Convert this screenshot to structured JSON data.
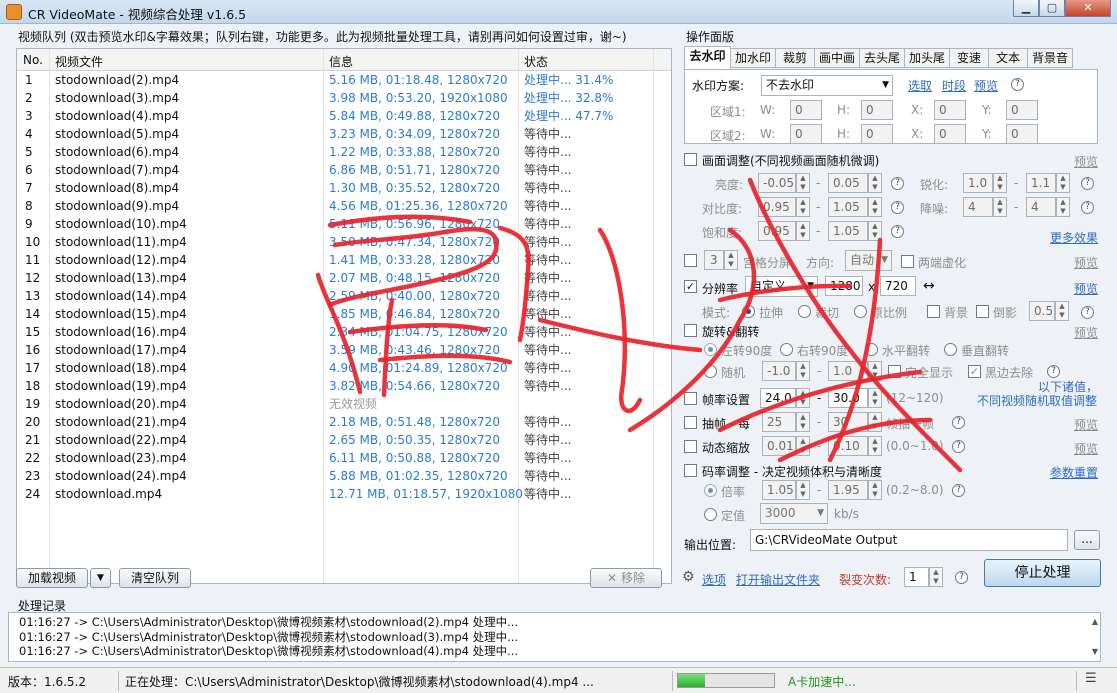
{
  "window": {
    "title": "CR VideoMate - 视频综合处理 v1.6.5"
  },
  "queue": {
    "group_label": "视频队列 (双击预览水印&字幕效果；队列右键，功能更多。此为视频批量处理工具，请别再问如何设置过审，谢~)",
    "columns": {
      "no": "No.",
      "file": "视频文件",
      "info": "信息",
      "status": "状态"
    },
    "rows": [
      {
        "no": "1",
        "file": "stodownload(2).mp4",
        "info": "5.16 MB, 01:18.48, 1280x720",
        "status": "处理中... 31.4%"
      },
      {
        "no": "2",
        "file": "stodownload(3).mp4",
        "info": "3.98 MB, 0:53.20, 1920x1080",
        "status": "处理中... 32.8%"
      },
      {
        "no": "3",
        "file": "stodownload(4).mp4",
        "info": "5.84 MB, 0:49.88, 1280x720",
        "status": "处理中... 47.7%"
      },
      {
        "no": "4",
        "file": "stodownload(5).mp4",
        "info": "3.23 MB, 0:34.09, 1280x720",
        "status": "等待中..."
      },
      {
        "no": "5",
        "file": "stodownload(6).mp4",
        "info": "1.22 MB, 0:33.88, 1280x720",
        "status": "等待中..."
      },
      {
        "no": "6",
        "file": "stodownload(7).mp4",
        "info": "6.86 MB, 0:51.71, 1280x720",
        "status": "等待中..."
      },
      {
        "no": "7",
        "file": "stodownload(8).mp4",
        "info": "1.30 MB, 0:35.52, 1280x720",
        "status": "等待中..."
      },
      {
        "no": "8",
        "file": "stodownload(9).mp4",
        "info": "4.56 MB, 01:25.36, 1280x720",
        "status": "等待中..."
      },
      {
        "no": "9",
        "file": "stodownload(10).mp4",
        "info": "5.11 MB, 0:56.96, 1280x720",
        "status": "等待中..."
      },
      {
        "no": "10",
        "file": "stodownload(11).mp4",
        "info": "3.50 MB, 0:47.34, 1280x720",
        "status": "等待中..."
      },
      {
        "no": "11",
        "file": "stodownload(12).mp4",
        "info": "1.41 MB, 0:33.28, 1280x720",
        "status": "等待中..."
      },
      {
        "no": "12",
        "file": "stodownload(13).mp4",
        "info": "2.07 MB, 0:48.15, 1280x720",
        "status": "等待中..."
      },
      {
        "no": "13",
        "file": "stodownload(14).mp4",
        "info": "2.59 MB, 0:40.00, 1280x720",
        "status": "等待中..."
      },
      {
        "no": "14",
        "file": "stodownload(15).mp4",
        "info": "1.85 MB, 0:46.84, 1280x720",
        "status": "等待中..."
      },
      {
        "no": "15",
        "file": "stodownload(16).mp4",
        "info": "2.34 MB, 01:04.75, 1280x720",
        "status": "等待中..."
      },
      {
        "no": "16",
        "file": "stodownload(17).mp4",
        "info": "3.59 MB, 0:43.46, 1280x720",
        "status": "等待中..."
      },
      {
        "no": "17",
        "file": "stodownload(18).mp4",
        "info": "4.90 MB, 01:24.89, 1280x720",
        "status": "等待中..."
      },
      {
        "no": "18",
        "file": "stodownload(19).mp4",
        "info": "3.82 MB, 0:54.66, 1280x720",
        "status": "等待中..."
      },
      {
        "no": "19",
        "file": "stodownload(20).mp4",
        "info": "无效视频",
        "status": ""
      },
      {
        "no": "20",
        "file": "stodownload(21).mp4",
        "info": "2.18 MB, 0:51.48, 1280x720",
        "status": "等待中..."
      },
      {
        "no": "21",
        "file": "stodownload(22).mp4",
        "info": "2.65 MB, 0:50.35, 1280x720",
        "status": "等待中..."
      },
      {
        "no": "22",
        "file": "stodownload(23).mp4",
        "info": "6.11 MB, 0:50.88, 1280x720",
        "status": "等待中..."
      },
      {
        "no": "23",
        "file": "stodownload(24).mp4",
        "info": "5.88 MB, 01:02.35, 1280x720",
        "status": "等待中..."
      },
      {
        "no": "24",
        "file": "stodownload.mp4",
        "info": "12.71 MB, 01:18.57, 1920x1080",
        "status": "等待中..."
      }
    ],
    "buttons": {
      "load": "加载视频",
      "clear": "清空队列",
      "remove": "移除"
    }
  },
  "ops": {
    "group_label": "操作面版",
    "tabs": [
      "去水印",
      "加水印",
      "裁剪",
      "画中画",
      "去头尾",
      "加头尾",
      "变速",
      "文本",
      "背景音"
    ],
    "watermark": {
      "scheme_label": "水印方案:",
      "scheme_value": "不去水印",
      "links": [
        "选取",
        "时段",
        "预览"
      ],
      "areas": [
        {
          "label": "区域1:",
          "w": "0",
          "h": "0",
          "x": "0",
          "y": "0"
        },
        {
          "label": "区域2:",
          "w": "0",
          "h": "0",
          "x": "0",
          "y": "0"
        }
      ],
      "w_label": "W:",
      "h_label": "H:",
      "x_label": "X:",
      "y_label": "Y:"
    },
    "picture": {
      "title": "画面调整(不同视频画面随机微调)",
      "preview": "预览",
      "brightness_label": "亮度:",
      "brightness": [
        "-0.05",
        "0.05"
      ],
      "sharpen_label": "锐化:",
      "sharpen": [
        "1.0",
        "1.1"
      ],
      "contrast_label": "对比度:",
      "contrast": [
        "0.95",
        "1.05"
      ],
      "denoise_label": "降噪:",
      "denoise": [
        "4",
        "4"
      ],
      "saturation_label": "饱和度:",
      "saturation": [
        "0.95",
        "1.05"
      ],
      "more": "更多效果"
    },
    "grid": {
      "count": "3",
      "label": "宫格分屏",
      "dir_label": "方向:",
      "dir_value": "自动",
      "blur": "两端虚化",
      "preview": "预览"
    },
    "resolution": {
      "label": "分辨率",
      "preset": "自定义",
      "w": "1280",
      "x": "x",
      "h": "720",
      "link_icon": "↔",
      "preview": "预览",
      "mode_label": "模式:",
      "modes": [
        "拉伸",
        "裁切",
        "原比例"
      ],
      "bg": "背景",
      "reflect": "倒影",
      "reflect_value": "0.5"
    },
    "rotate": {
      "label": "旋转&翻转",
      "options": [
        "左转90度",
        "右转90度",
        "水平翻转",
        "垂直翻转"
      ],
      "random": "随机",
      "range": [
        "-1.0",
        "1.0"
      ],
      "full": "完全显示",
      "blackedge": "黑边去除",
      "preview": "预览"
    },
    "note": [
      "以下诸值，",
      "不同视频随机取值调整"
    ],
    "fps": {
      "label": "帧率设置",
      "min": "24.0",
      "max": "30.0",
      "range": "(12~120)"
    },
    "drop": {
      "label": "抽帧 - 每",
      "a": "25",
      "b": "30",
      "suffix": "帧抽一帧",
      "preview": "预览"
    },
    "zoom": {
      "label": "动态缩放",
      "a": "0.01",
      "b": "0.10",
      "range": "(0.0~1.0)",
      "preview": "预览"
    },
    "bitrate": {
      "label": "码率调整 - 决定视频体积与清晰度",
      "reset": "参数重置",
      "ratio_label": "倍率",
      "ratio": [
        "1.05",
        "1.95"
      ],
      "ratio_range": "(0.2~8.0)",
      "fixed_label": "定值",
      "fixed": "3000",
      "unit": "kb/s"
    },
    "output": {
      "label": "输出位置:",
      "path": "G:\\CRVideoMate Output",
      "browse": "..."
    },
    "footer": {
      "options": "选项",
      "open": "打开输出文件夹",
      "fission_label": "裂变次数:",
      "fission": "1",
      "stop": "停止处理"
    }
  },
  "log": {
    "label": "处理记录",
    "lines": [
      "01:16:27 -> C:\\Users\\Administrator\\Desktop\\微博视频素材\\stodownload(2).mp4 处理中...",
      "01:16:27 -> C:\\Users\\Administrator\\Desktop\\微博视频素材\\stodownload(3).mp4 处理中...",
      "01:16:27 -> C:\\Users\\Administrator\\Desktop\\微博视频素材\\stodownload(4).mp4 处理中..."
    ]
  },
  "statusbar": {
    "version": "版本：1.6.5.2",
    "processing": "正在处理：C:\\Users\\Administrator\\Desktop\\微博视频素材\\stodownload(4).mp4 ...",
    "progress": 0.28,
    "accel": "A卡加速中..."
  },
  "colors": {
    "link": "#2b6cc4",
    "info": "#2b7bd4",
    "overlay": "#e8232a",
    "progress": "#2fbf2f",
    "accel": "#1a9a1a",
    "fission": "#c0392b"
  }
}
